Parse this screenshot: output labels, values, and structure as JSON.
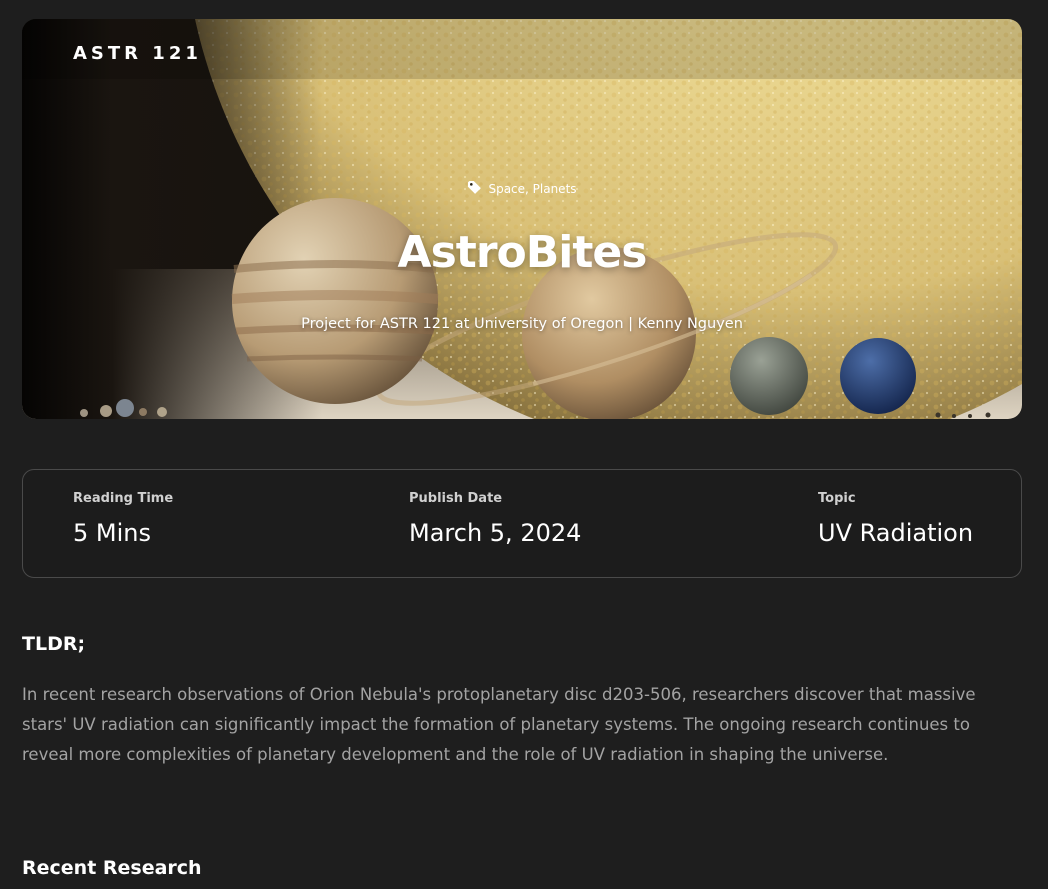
{
  "hero": {
    "brand": "ASTR 121",
    "tags": "Space, Planets",
    "title": "AstroBites",
    "subtitle": "Project for ASTR 121 at University of Oregon | Kenny Nguyen"
  },
  "meta": {
    "reading_time": {
      "label": "Reading Time",
      "value": "5 Mins"
    },
    "publish_date": {
      "label": "Publish Date",
      "value": "March 5, 2024"
    },
    "topic": {
      "label": "Topic",
      "value": "UV Radiation"
    }
  },
  "tldr": {
    "heading": "TLDR;",
    "body": "In recent research observations of Orion Nebula's protoplanetary disc d203-506, researchers discover that massive stars' UV radiation can significantly impact the formation of planetary systems. The ongoing research continues to reveal more complexities of planetary development and the role of UV radiation in shaping the universe."
  },
  "recent_research": {
    "heading": "Recent Research"
  },
  "colors": {
    "background": "#1e1e1e",
    "card_border": "#4a4a4a",
    "body_text": "#a3a3a3",
    "heading_text": "#ffffff"
  },
  "icons": {
    "tag": "tag-icon"
  }
}
